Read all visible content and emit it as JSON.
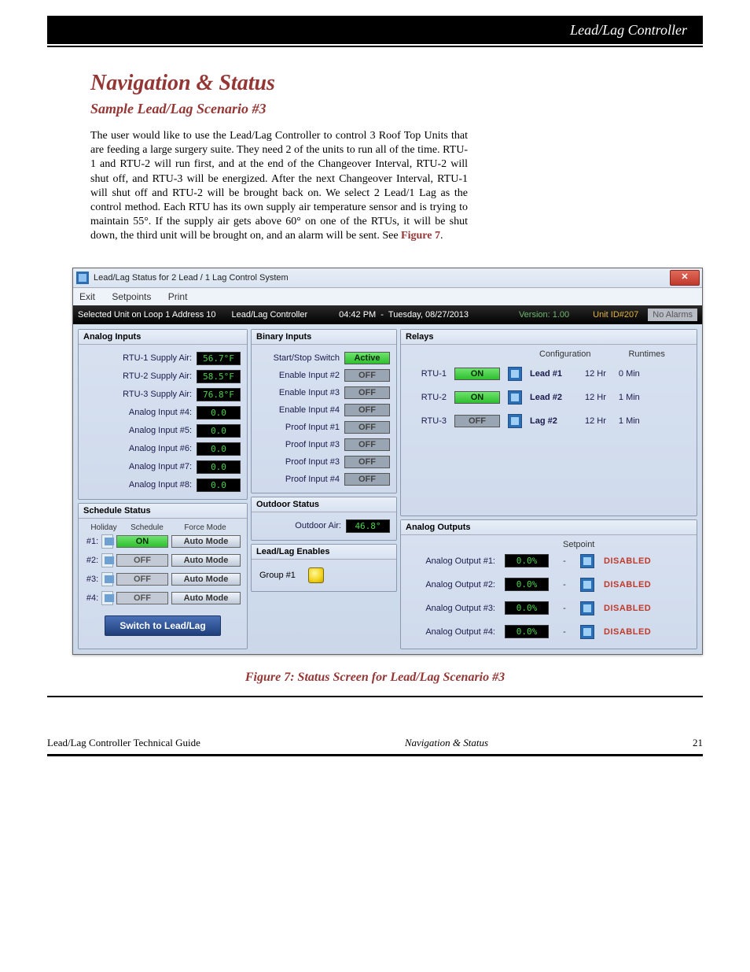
{
  "doc": {
    "banner_right": "Lead/Lag Controller",
    "heading": "Navigation & Status",
    "sub_heading": "Sample Lead/Lag Scenario #3",
    "body": "The user would like to use the Lead/Lag Controller to control 3 Roof Top Units that are feeding a large surgery suite. They need 2 of the units to run all of the time. RTU-1 and RTU-2 will run first, and at the end of the Changeover Interval, RTU-2 will shut off, and RTU-3 will be energized. After the next Changeover Interval, RTU-1 will shut off and RTU-2 will be brought back on. We select 2 Lead/1 Lag as the control method. Each RTU has its own supply air temperature sensor and is trying to maintain 55°. If the supply air gets above 60° on one of the RTUs, it will be shut down, the third unit will be brought on, and an alarm will be sent.  See ",
    "see_ref": "Figure 7",
    "figure_caption": "Figure 7: Status Screen for Lead/Lag Scenario #3",
    "footer_left": "Lead/Lag Controller Technical Guide",
    "footer_mid": "Navigation & Status",
    "footer_right": "21"
  },
  "win": {
    "title": "Lead/Lag Status for 2 Lead / 1 Lag Control System",
    "menu": {
      "exit": "Exit",
      "setpoints": "Setpoints",
      "print": "Print"
    },
    "status": {
      "selected": "Selected Unit on Loop 1 Address 10",
      "controller": "Lead/Lag Controller",
      "time": "04:42 PM",
      "dash": "-",
      "date": "Tuesday, 08/27/2013",
      "version": "Version: 1.00",
      "unitid": "Unit ID#207",
      "noalarms": "No Alarms"
    },
    "analog_inputs": {
      "title": "Analog Inputs",
      "rows": [
        {
          "label": "RTU-1 Supply Air:",
          "value": "56.7°F"
        },
        {
          "label": "RTU-2 Supply Air:",
          "value": "58.5°F"
        },
        {
          "label": "RTU-3 Supply Air:",
          "value": "76.8°F"
        },
        {
          "label": "Analog Input #4:",
          "value": "0.0"
        },
        {
          "label": "Analog Input #5:",
          "value": "0.0"
        },
        {
          "label": "Analog Input #6:",
          "value": "0.0"
        },
        {
          "label": "Analog Input #7:",
          "value": "0.0"
        },
        {
          "label": "Analog Input #8:",
          "value": "0.0"
        }
      ]
    },
    "binary_inputs": {
      "title": "Binary Inputs",
      "rows": [
        {
          "label": "Start/Stop Switch",
          "state": "Active"
        },
        {
          "label": "Enable Input #2",
          "state": "OFF"
        },
        {
          "label": "Enable Input #3",
          "state": "OFF"
        },
        {
          "label": "Enable Input #4",
          "state": "OFF"
        },
        {
          "label": "Proof Input #1",
          "state": "OFF"
        },
        {
          "label": "Proof Input #3",
          "state": "OFF"
        },
        {
          "label": "Proof Input #3",
          "state": "OFF"
        },
        {
          "label": "Proof Input #4",
          "state": "OFF"
        }
      ]
    },
    "schedule": {
      "title": "Schedule Status",
      "cols": {
        "holiday": "Holiday",
        "schedule": "Schedule",
        "force": "Force Mode"
      },
      "rows": [
        {
          "idx": "#1:",
          "sched": "ON",
          "force": "Auto Mode"
        },
        {
          "idx": "#2:",
          "sched": "OFF",
          "force": "Auto Mode"
        },
        {
          "idx": "#3:",
          "sched": "OFF",
          "force": "Auto Mode"
        },
        {
          "idx": "#4:",
          "sched": "OFF",
          "force": "Auto Mode"
        }
      ],
      "button": "Switch to Lead/Lag"
    },
    "outdoor": {
      "title": "Outdoor Status",
      "label": "Outdoor Air:",
      "value": "46.8°"
    },
    "leadlag_enables": {
      "title": "Lead/Lag Enables",
      "label": "Group #1"
    },
    "relays": {
      "title": "Relays",
      "cols": {
        "cfg": "Configuration",
        "rt": "Runtimes"
      },
      "rows": [
        {
          "name": "RTU-1",
          "state": "ON",
          "cfg": "Lead #1",
          "hr": "12 Hr",
          "min": "0 Min"
        },
        {
          "name": "RTU-2",
          "state": "ON",
          "cfg": "Lead #2",
          "hr": "12 Hr",
          "min": "1 Min"
        },
        {
          "name": "RTU-3",
          "state": "OFF",
          "cfg": "Lag  #2",
          "hr": "12 Hr",
          "min": "1 Min"
        }
      ]
    },
    "analog_outputs": {
      "title": "Analog Outputs",
      "setpoint_hdr": "Setpoint",
      "rows": [
        {
          "label": "Analog Output #1:",
          "value": "0.0%",
          "sp": "-",
          "status": "DISABLED"
        },
        {
          "label": "Analog Output #2:",
          "value": "0.0%",
          "sp": "-",
          "status": "DISABLED"
        },
        {
          "label": "Analog Output #3:",
          "value": "0.0%",
          "sp": "-",
          "status": "DISABLED"
        },
        {
          "label": "Analog Output #4:",
          "value": "0.0%",
          "sp": "-",
          "status": "DISABLED"
        }
      ]
    }
  }
}
